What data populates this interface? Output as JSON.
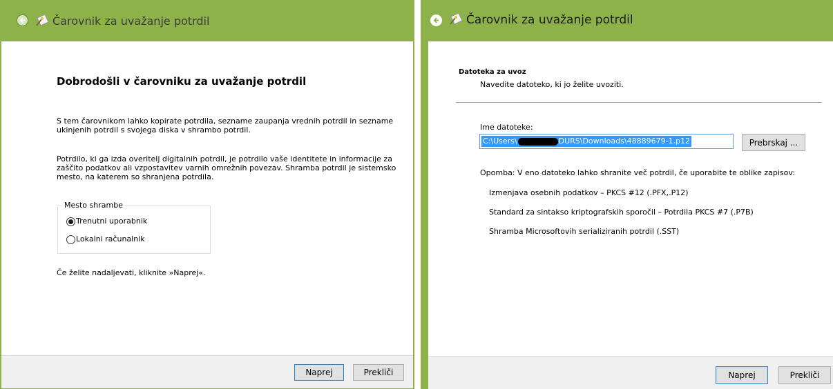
{
  "left_window": {
    "title": "Čarovnik za uvažanje potrdil",
    "heading": "Dobrodošli v čarovniku za uvažanje potrdil",
    "intro_line1": "S tem čarovnikom lahko kopirate potrdila, sezname zaupanja vrednih potrdil in sezname",
    "intro_line2": "ukinjenih potrdil s svojega diska v shrambo potrdil.",
    "info_line1": "Potrdilo, ki ga izda overitelj digitalnih potrdil, je potrdilo vaše identitete in informacije za",
    "info_line2": "zaščito podatkov ali vzpostavitev varnih omrežnih povezav. Shramba potrdil je sistemsko",
    "info_line3": "mesto, na katerem so shranjena potrdila.",
    "store_group_label": "Mesto shrambe",
    "option_current_user": "Trenutni uporabnik",
    "option_local_machine": "Lokalni računalnik",
    "selected_option": "Trenutni uporabnik",
    "continue_text": "Če želite nadaljevati, kliknite »Naprej«.",
    "next_label": "Naprej",
    "cancel_label": "Prekliči"
  },
  "right_window": {
    "title": "Čarovnik za uvažanje potrdil",
    "section_title": "Datoteka za uvoz",
    "section_subtitle": "Navedite datoteko, ki jo želite uvoziti.",
    "file_name_label": "Ime datoteke:",
    "file_path_start": "C:\\Users\\",
    "file_path_end": "DURS\\Downloads\\48889679-1.p12",
    "browse_label": "Prebrskaj ...",
    "note": "Opomba: V eno datoteko lahko shranite več potrdil, če uporabite te oblike zapisov:",
    "formats": [
      "Izmenjava osebnih podatkov – PKCS #12 (.PFX,.P12)",
      "Standard za sintakso kriptografskih sporočil – Potrdila PKCS #7 (.P7B)",
      "Shramba Microsoftovih serializiranih potrdil (.SST)"
    ],
    "next_label": "Naprej",
    "cancel_label": "Prekliči"
  },
  "colors": {
    "titlebar": "#8db24a",
    "selection": "#3399ff",
    "footer": "#f0f0f0"
  }
}
